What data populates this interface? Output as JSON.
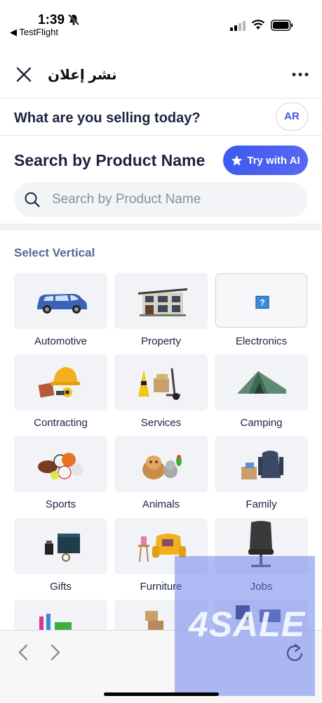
{
  "status_bar": {
    "time": "1:39",
    "back_app": "◀ TestFlight"
  },
  "header": {
    "title": "نشر إعلان"
  },
  "sell_row": {
    "question": "What are you selling today?",
    "lang_button": "AR"
  },
  "search": {
    "title": "Search by Product Name",
    "ai_button": "Try with AI",
    "placeholder": "Search by Product Name"
  },
  "verticals": {
    "heading": "Select Vertical",
    "items": [
      {
        "label": "Automotive",
        "icon": "car-image"
      },
      {
        "label": "Property",
        "icon": "house-image"
      },
      {
        "label": "Electronics",
        "icon": "broken-image-placeholder"
      },
      {
        "label": "Contracting",
        "icon": "hard-hat-tools-image"
      },
      {
        "label": "Services",
        "icon": "hand-truck-boxes-image"
      },
      {
        "label": "Camping",
        "icon": "tent-image"
      },
      {
        "label": "Sports",
        "icon": "balls-image"
      },
      {
        "label": "Animals",
        "icon": "pets-image"
      },
      {
        "label": "Family",
        "icon": "clothes-toys-image"
      },
      {
        "label": "Gifts",
        "icon": "gift-box-image"
      },
      {
        "label": "Furniture",
        "icon": "armchair-image"
      },
      {
        "label": "Jobs",
        "icon": "office-chair-image"
      }
    ]
  },
  "watermark": {
    "text": "4SALE"
  },
  "colors": {
    "accent": "#3b5bf0",
    "heading": "#1c2340",
    "tile_bg": "#f2f3f7",
    "watermark": "#5f78eb"
  }
}
